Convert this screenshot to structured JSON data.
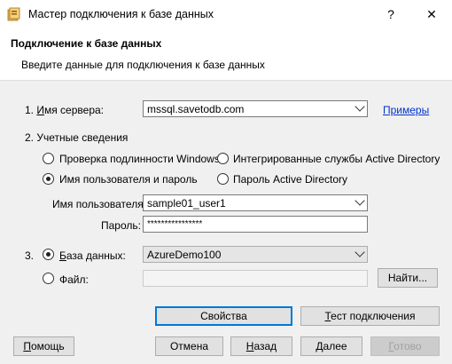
{
  "window": {
    "title": "Мастер подключения к базе данных",
    "help_glyph": "?",
    "close_glyph": "✕"
  },
  "header": {
    "title": "Подключение к базе данных",
    "subtitle": "Введите данные для подключения к базе данных"
  },
  "server": {
    "label": "1. Имя сервера:",
    "value": "mssql.savetodb.com",
    "examples_link": "Примеры"
  },
  "credentials": {
    "label": "2. Учетные сведения",
    "options": {
      "windows_auth": "Проверка подлинности Windows",
      "ad_integrated": "Интегрированные службы Active Directory",
      "user_password": "Имя пользователя и пароль",
      "ad_password": "Пароль Active Directory"
    },
    "selected": "user_password",
    "username_label": "Имя пользователя:",
    "username_value": "sample01_user1",
    "password_label": "Пароль:",
    "password_value": "****************"
  },
  "database": {
    "step": "3.",
    "db_label": "База данных:",
    "db_value": "AzureDemo100",
    "file_label": "Файл:",
    "file_value": "",
    "find_button": "Найти...",
    "selected": "database"
  },
  "buttons": {
    "properties": "Свойства",
    "test": "Тест подключения",
    "help": "Помощь",
    "cancel": "Отмена",
    "back": "Назад",
    "next": "Далее",
    "finish": "Готово"
  },
  "colors": {
    "link": "#0033cc",
    "default_button_border": "#0078d7"
  }
}
